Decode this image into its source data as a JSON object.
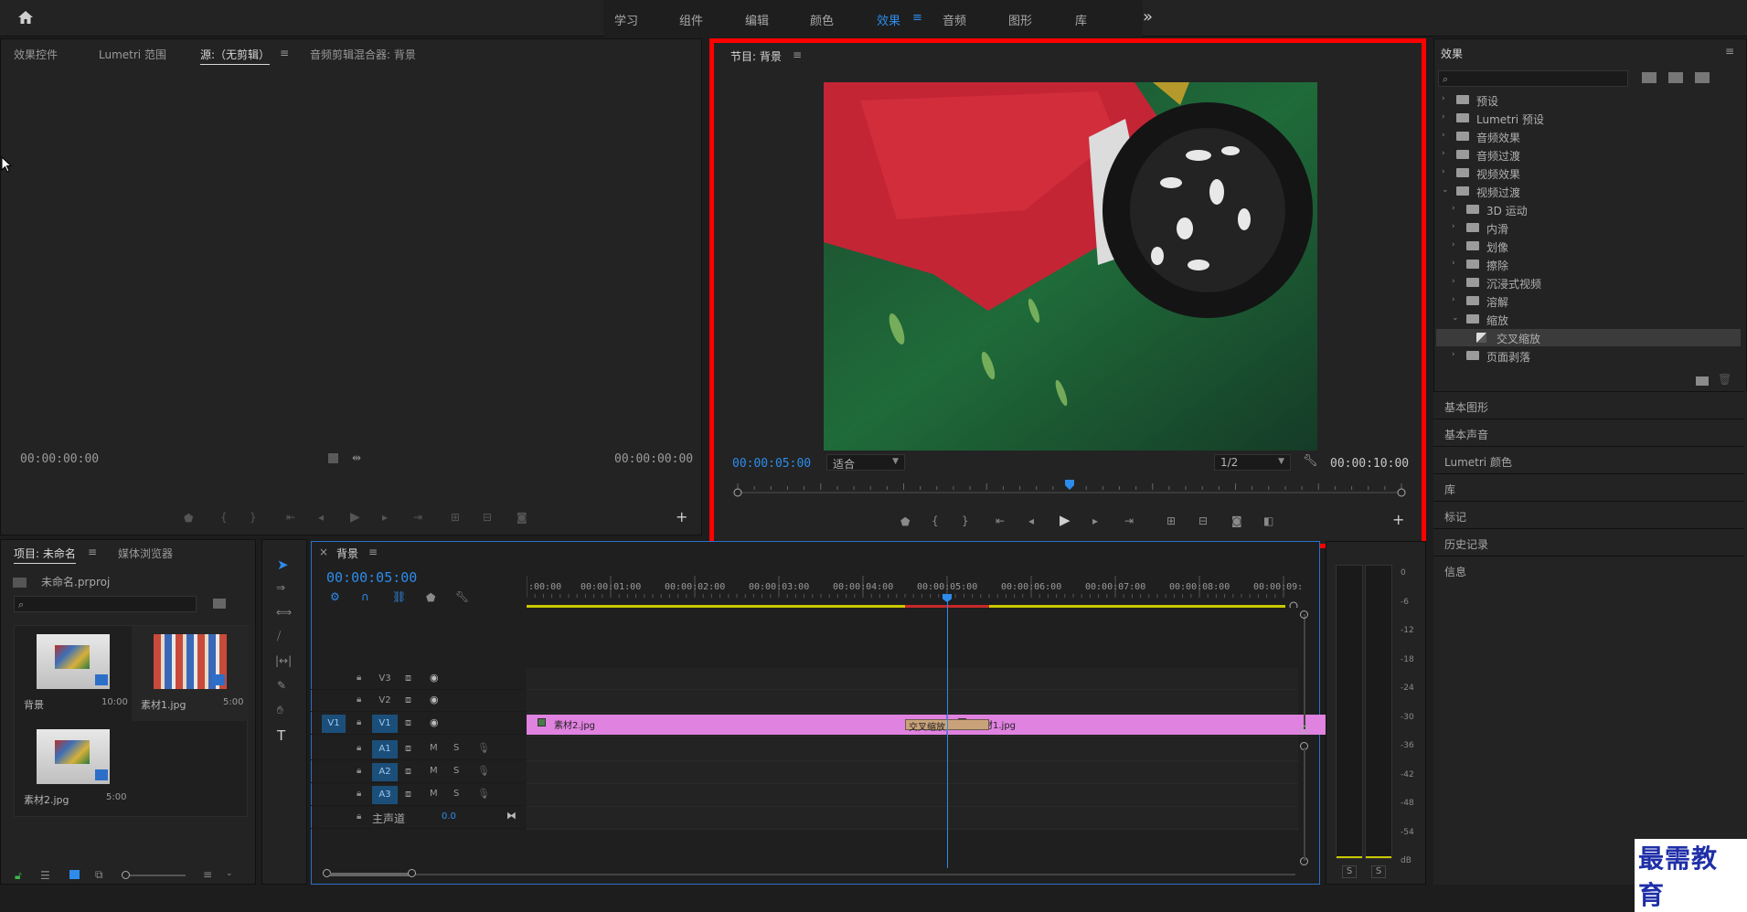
{
  "topbar": {
    "tabs": [
      {
        "label": "学习",
        "active": false
      },
      {
        "label": "组件",
        "active": false
      },
      {
        "label": "编辑",
        "active": false
      },
      {
        "label": "颜色",
        "active": false
      },
      {
        "label": "效果",
        "active": true
      },
      {
        "label": "音频",
        "active": false
      },
      {
        "label": "图形",
        "active": false
      },
      {
        "label": "库",
        "active": false
      }
    ],
    "more": "»",
    "menu_icon": "≡"
  },
  "source_panel": {
    "tabs": [
      "效果控件",
      "Lumetri 范围",
      "源:（无剪辑）",
      "音频剪辑混合器: 背景"
    ],
    "active_tab": "源:（无剪辑）",
    "timecode_left": "00:00:00:00",
    "timecode_right": "00:00:00:00"
  },
  "program_panel": {
    "title": "节目: 背景",
    "timecode": "00:00:05:00",
    "fit_label": "适合",
    "resolution": "1/2",
    "duration": "00:00:10:00",
    "playhead_fraction": 0.5
  },
  "effects_panel": {
    "title": "效果",
    "search_placeholder": "",
    "tree": [
      {
        "label": "预设",
        "level": 0,
        "expanded": false,
        "type": "folder-special"
      },
      {
        "label": "Lumetri 预设",
        "level": 0,
        "expanded": false,
        "type": "folder-special"
      },
      {
        "label": "音频效果",
        "level": 0,
        "expanded": false,
        "type": "folder"
      },
      {
        "label": "音频过渡",
        "level": 0,
        "expanded": false,
        "type": "folder"
      },
      {
        "label": "视频效果",
        "level": 0,
        "expanded": false,
        "type": "folder"
      },
      {
        "label": "视频过渡",
        "level": 0,
        "expanded": true,
        "type": "folder"
      },
      {
        "label": "3D 运动",
        "level": 1,
        "expanded": false,
        "type": "folder"
      },
      {
        "label": "内滑",
        "level": 1,
        "expanded": false,
        "type": "folder"
      },
      {
        "label": "划像",
        "level": 1,
        "expanded": false,
        "type": "folder"
      },
      {
        "label": "擦除",
        "level": 1,
        "expanded": false,
        "type": "folder"
      },
      {
        "label": "沉浸式视频",
        "level": 1,
        "expanded": false,
        "type": "folder"
      },
      {
        "label": "溶解",
        "level": 1,
        "expanded": false,
        "type": "folder"
      },
      {
        "label": "缩放",
        "level": 1,
        "expanded": true,
        "type": "folder"
      },
      {
        "label": "交叉缩放",
        "level": 2,
        "expanded": false,
        "type": "effect",
        "selected": true
      },
      {
        "label": "页面剥落",
        "level": 1,
        "expanded": false,
        "type": "folder"
      }
    ],
    "side_sections": [
      "基本图形",
      "基本声音",
      "Lumetri 颜色",
      "库",
      "标记",
      "历史记录",
      "信息"
    ]
  },
  "project_panel": {
    "tabs": [
      "项目: 未命名",
      "媒体浏览器"
    ],
    "active_tab": "项目: 未命名",
    "project_file": "未命名.prproj",
    "items": [
      {
        "name": "背景",
        "duration": "10:00"
      },
      {
        "name": "素材1.jpg",
        "duration": "5:00"
      },
      {
        "name": "素材2.jpg",
        "duration": "5:00"
      }
    ]
  },
  "timeline_panel": {
    "title": "背景",
    "close": "×",
    "timecode": "00:00:05:00",
    "ruler_labels": [
      ":00:00",
      "00:00:01:00",
      "00:00:02:00",
      "00:00:03:00",
      "00:00:04:00",
      "00:00:05:00",
      "00:00:06:00",
      "00:00:07:00",
      "00:00:08:00",
      "00:00:09:"
    ],
    "video_tracks": [
      "V3",
      "V2",
      "V1"
    ],
    "audio_tracks": [
      "A1",
      "A2",
      "A3"
    ],
    "source_patch_v": "V1",
    "master_label": "主声道",
    "master_value": "0.0",
    "m_label": "M",
    "s_label": "S",
    "clips": [
      {
        "name": "素材2.jpg",
        "start": 0,
        "end": 5
      },
      {
        "name": "素材1.jpg",
        "start": 5,
        "end": 10
      }
    ],
    "transition": {
      "name": "交叉缩放",
      "start": 4.5,
      "end": 5.5
    },
    "playhead_seconds": 5
  },
  "audio_meter": {
    "db_labels": [
      "0",
      "-6",
      "-12",
      "-18",
      "-24",
      "-30",
      "-36",
      "-42",
      "-48",
      "-54",
      "dB"
    ],
    "solo_labels": [
      "S",
      "S"
    ]
  },
  "watermark": "最需教育",
  "colors": {
    "accent": "#2d8ceb",
    "clip": "#e082e0",
    "highlight_box": "#ff0000",
    "transition": "#c9a27a"
  }
}
